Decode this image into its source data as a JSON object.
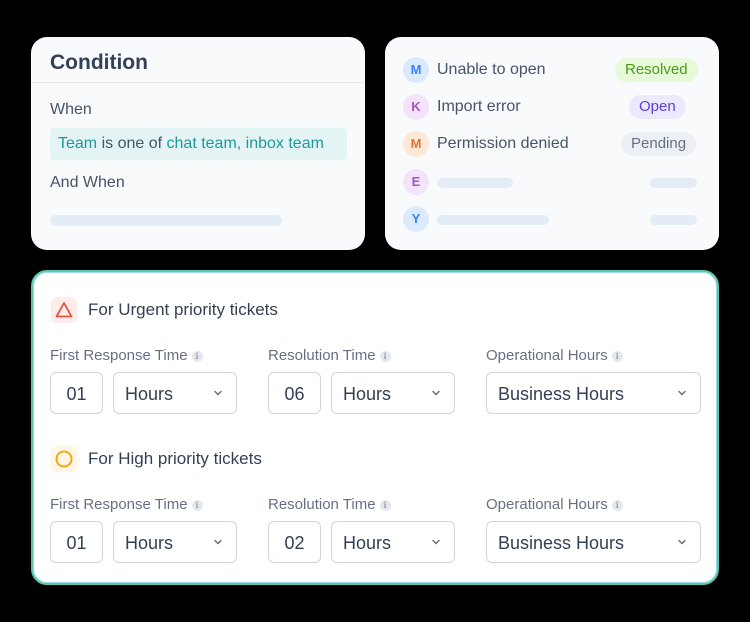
{
  "condition": {
    "title": "Condition",
    "when_label": "When",
    "chip": {
      "field": "Team",
      "operator": "is one of",
      "values": "chat team, inbox team"
    },
    "and_when_label": "And When"
  },
  "tickets": [
    {
      "initial": "M",
      "title": "Unable to open",
      "status": "Resolved",
      "avatar_bg": "#dbeafe",
      "avatar_fg": "#3b82f6",
      "status_bg": "#e6f9d8",
      "status_fg": "#4d9a1a"
    },
    {
      "initial": "K",
      "title": "Import error",
      "status": "Open",
      "avatar_bg": "#f3e3fb",
      "avatar_fg": "#a855c7",
      "status_bg": "#ece9fe",
      "status_fg": "#5b3fd6"
    },
    {
      "initial": "M",
      "title": "Permission denied",
      "status": "Pending",
      "avatar_bg": "#fde7d6",
      "avatar_fg": "#d9773a",
      "status_bg": "#eceff3",
      "status_fg": "#667085"
    },
    {
      "initial": "E",
      "title": "",
      "status": "",
      "avatar_bg": "#f3e3fb",
      "avatar_fg": "#a855c7"
    },
    {
      "initial": "Y",
      "title": "",
      "status": "",
      "avatar_bg": "#dbeafe",
      "avatar_fg": "#3b82f6"
    }
  ],
  "sla": {
    "urgent": {
      "title": "For Urgent priority tickets",
      "icon": "warning-triangle-icon",
      "icon_color": "#e5533d",
      "first_response": {
        "label": "First Response Time",
        "value": "01",
        "unit": "Hours"
      },
      "resolution": {
        "label": "Resolution Time",
        "value": "06",
        "unit": "Hours"
      },
      "operational": {
        "label": "Operational Hours",
        "value": "Business Hours"
      }
    },
    "high": {
      "title": "For High priority tickets",
      "icon": "circle-icon",
      "icon_color": "#f0a91a",
      "first_response": {
        "label": "First Response Time",
        "value": "01",
        "unit": "Hours"
      },
      "resolution": {
        "label": "Resolution Time",
        "value": "02",
        "unit": "Hours"
      },
      "operational": {
        "label": "Operational Hours",
        "value": "Business Hours"
      }
    }
  },
  "info_glyph": "i"
}
